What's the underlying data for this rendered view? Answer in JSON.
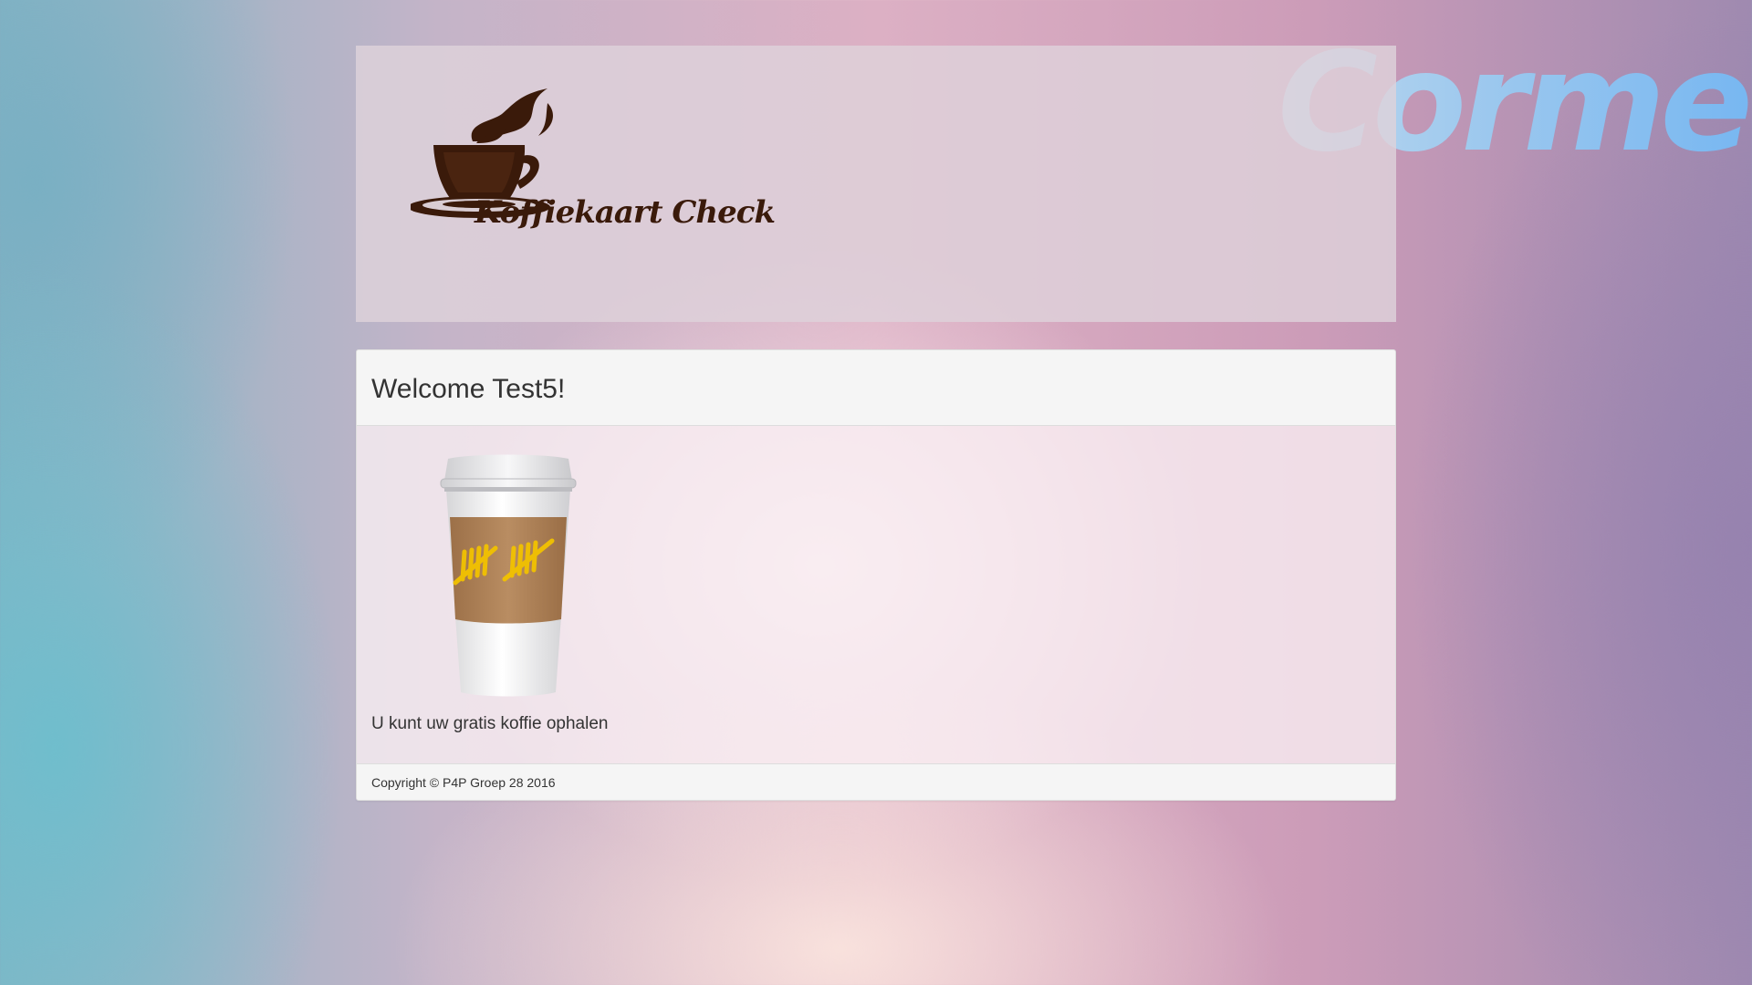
{
  "brand": {
    "watermark": "Cormet",
    "logo_text": "Koffiekaart Check"
  },
  "panel": {
    "title": "Welcome Test5!",
    "message": "U kunt uw gratis koffie ophalen",
    "footer": "Copyright © P4P Groep 28 2016"
  },
  "icons": {
    "logo": "coffee-cup-steam-icon",
    "card": "takeaway-coffee-cup-tally-icon"
  },
  "colors": {
    "panel_heading_bg": "#f5f5f5",
    "text": "#333333",
    "logo_brown": "#3a1a0a",
    "cup_sleeve": "#b0845a",
    "tally_marks": "#f2c200",
    "watermark_blue": "#6fb3f2"
  }
}
